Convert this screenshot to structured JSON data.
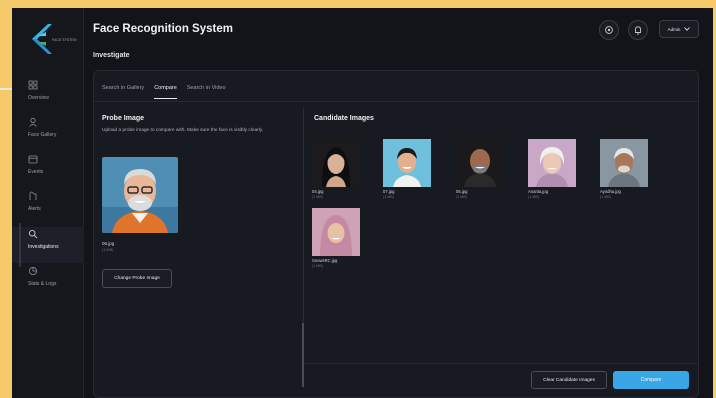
{
  "app": {
    "title": "Face Recognition System",
    "logo_text": "FACE SYSTEM"
  },
  "sidebar": {
    "items": [
      {
        "label": "Overview",
        "icon": "grid-icon"
      },
      {
        "label": "Face Gallery",
        "icon": "face-icon"
      },
      {
        "label": "Events",
        "icon": "calendar-icon"
      },
      {
        "label": "Alerts",
        "icon": "alert-icon"
      },
      {
        "label": "Investigations",
        "icon": "search-icon",
        "active": true
      },
      {
        "label": "Stats & Logs",
        "icon": "chart-icon"
      }
    ]
  },
  "header": {
    "settings_icon": "gear-icon",
    "notifications_icon": "bell-icon",
    "user_label": "Admin"
  },
  "page": {
    "subtitle": "Investigate"
  },
  "tabs": [
    {
      "label": "Search in Gallery"
    },
    {
      "label": "Compare",
      "active": true
    },
    {
      "label": "Search in Video"
    }
  ],
  "probe": {
    "title": "Probe Image",
    "description": "Upload a probe image to compare with. Make sure the face is visibly clearly.",
    "file_name": "06.jpg",
    "file_size": "(1 MB)",
    "change_button": "Change Probe Image"
  },
  "candidates": {
    "title": "Candidate Images",
    "items": [
      {
        "name": "04.jpg",
        "size": "(1 MB)"
      },
      {
        "name": "07.jpg",
        "size": "(1 MB)"
      },
      {
        "name": "05.jpg",
        "size": "(1 MB)"
      },
      {
        "name": "Ananta.jpg",
        "size": "(1 MB)"
      },
      {
        "name": "Ayodha.jpg",
        "size": "(1 MB)"
      },
      {
        "name": "SnowsRC.jpg",
        "size": "(1 MB)"
      }
    ]
  },
  "actions": {
    "clear_button": "Clear Candidate Images",
    "compare_button": "Compare"
  },
  "colors": {
    "accent": "#3aa6e6",
    "background": "#12141a",
    "panel": "#181a21",
    "frame": "#f6c96a"
  }
}
